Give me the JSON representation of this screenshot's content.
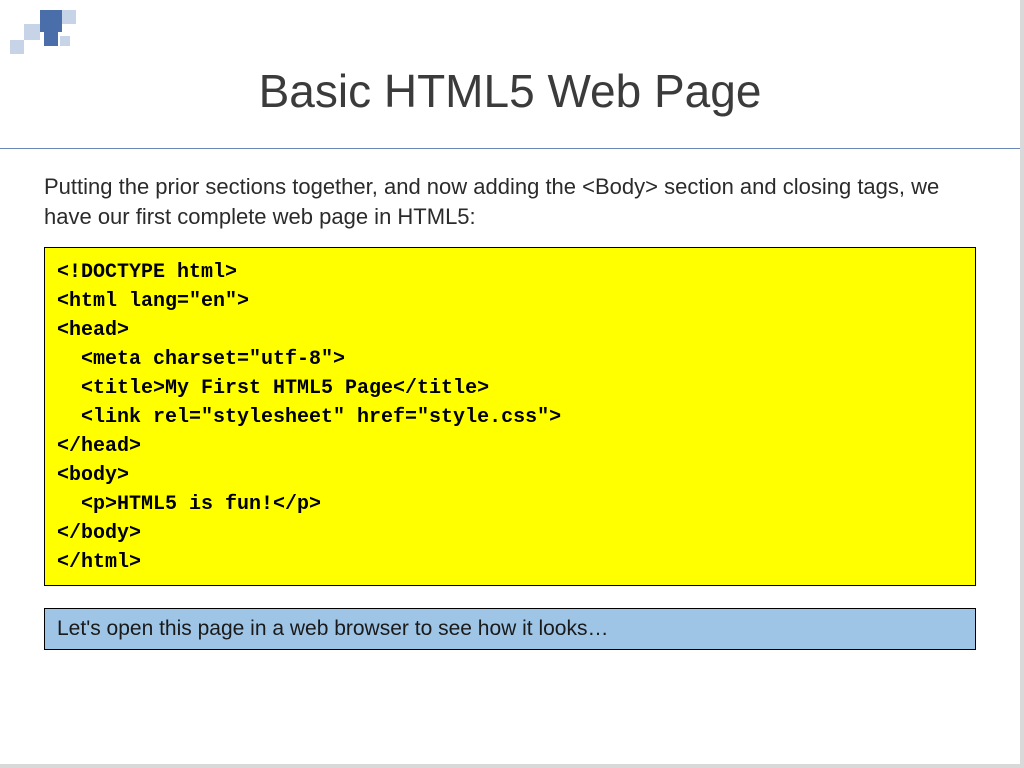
{
  "title": "Basic HTML5 Web Page",
  "intro": "Putting the prior sections together, and now adding the <Body> section and closing tags, we have our first complete web page in HTML5:",
  "code": {
    "l1": "<!DOCTYPE html>",
    "l2": "<html lang=\"en\">",
    "l3": "<head>",
    "l4": "<meta charset=\"utf-8\">",
    "l5": "<title>My First HTML5 Page</title>",
    "l6": "<link rel=\"stylesheet\" href=\"style.css\">",
    "l7": "</head>",
    "l8": "<body>",
    "l9": "<p>HTML5 is fun!</p>",
    "l10": "</body>",
    "l11": "</html>"
  },
  "callout": "Let's open this page in a web browser to see how it looks…"
}
